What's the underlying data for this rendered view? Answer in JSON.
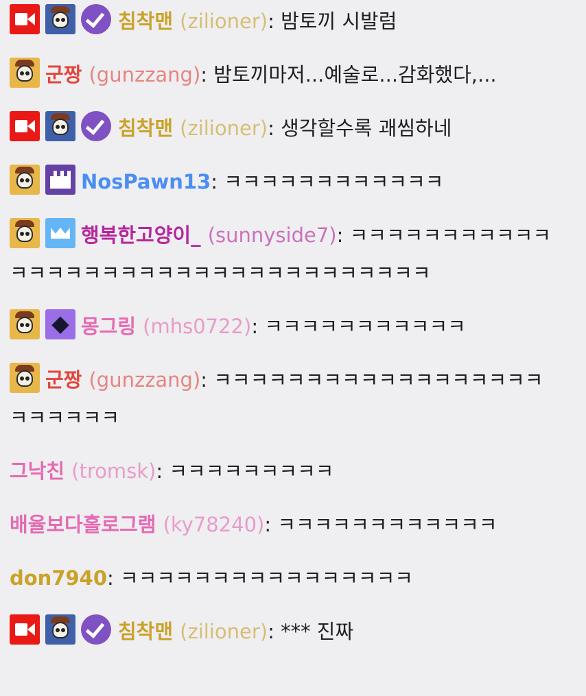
{
  "colors": {
    "gold": "#c9a227",
    "red": "#e2463c",
    "blue": "#4a8ef2",
    "purple": "#b5269c",
    "pink": "#e46bb2",
    "background": "#efeef1",
    "message_text": "#1f1f23"
  },
  "messages": [
    {
      "badges": [
        "video-icon",
        "skull-icon",
        "verified-icon"
      ],
      "display": "침착맨",
      "login": "(zilioner)",
      "text": "밤토끼 시발럼"
    },
    {
      "badges": [
        "skull-icon"
      ],
      "display": "군짱",
      "login": "(gunzzang)",
      "text": "밤토끼마저...예술로...감화했다,..."
    },
    {
      "badges": [
        "video-icon",
        "skull-icon",
        "verified-icon"
      ],
      "display": "침착맨",
      "login": "(zilioner)",
      "text": "생각할수록 괘씸하네"
    },
    {
      "badges": [
        "skull-icon",
        "clapper-icon"
      ],
      "display": "NosPawn13",
      "login": "",
      "text": "ㅋㅋㅋㅋㅋㅋㅋㅋㅋㅋㅋㅋ"
    },
    {
      "badges": [
        "skull-icon",
        "crown-icon"
      ],
      "display": "행복한고양이_",
      "login": "(sunnyside7)",
      "text": "ㅋㅋㅋㅋㅋㅋㅋㅋㅋㅋㅋㅋㅋㅋㅋㅋㅋㅋㅋㅋㅋㅋㅋㅋㅋㅋㅋㅋㅋㅋㅋㅋㅋㅋ"
    },
    {
      "badges": [
        "skull-icon",
        "gem-icon"
      ],
      "display": "몽그링",
      "login": "(mhs0722)",
      "text": "ㅋㅋㅋㅋㅋㅋㅋㅋㅋㅋㅋ"
    },
    {
      "badges": [
        "skull-icon"
      ],
      "display": "군짱",
      "login": "(gunzzang)",
      "text": "ㅋㅋㅋㅋㅋㅋㅋㅋㅋㅋㅋㅋㅋㅋㅋㅋㅋㅋㅋㅋㅋㅋㅋㅋ"
    },
    {
      "badges": [],
      "display": "그낙친",
      "login": "(tromsk)",
      "text": "ㅋㅋㅋㅋㅋㅋㅋㅋㅋ"
    },
    {
      "badges": [],
      "display": "배율보다홀로그램",
      "login": "(ky78240)",
      "text": "ㅋㅋㅋㅋㅋㅋㅋㅋㅋㅋㅋㅋ"
    },
    {
      "badges": [],
      "display": "don7940",
      "login": "",
      "text": "ㅋㅋㅋㅋㅋㅋㅋㅋㅋㅋㅋㅋㅋㅋㅋㅋ"
    },
    {
      "badges": [
        "video-icon",
        "skull-icon",
        "verified-icon"
      ],
      "display": "침착맨",
      "login": "(zilioner)",
      "text": "*** 진짜"
    }
  ],
  "colon": ":"
}
